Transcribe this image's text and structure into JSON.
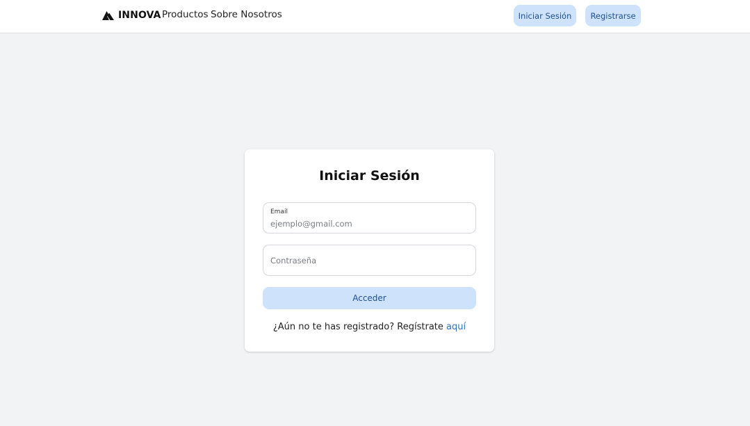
{
  "navbar": {
    "brand": {
      "icon": "innova-logo-icon",
      "name": "INNOVA"
    },
    "links": {
      "products": "Productos",
      "about": "Sobre Nosotros"
    },
    "buttons": {
      "login": "Iniciar Sesión",
      "register": "Registrarse"
    }
  },
  "login_card": {
    "title": "Iniciar Sesión",
    "email": {
      "label": "Email",
      "value": "",
      "placeholder": "ejemplo@gmail.com"
    },
    "password": {
      "value": "",
      "placeholder": "Contraseña"
    },
    "submit_label": "Acceder",
    "register_prompt": "¿Aún no te has registrado? Regístrate",
    "register_link": "aquí"
  },
  "colors": {
    "page_background": "#f2f3f5",
    "button_background": "#cfe2fb",
    "button_text": "#1d4f91",
    "link": "#2f6fc7"
  }
}
